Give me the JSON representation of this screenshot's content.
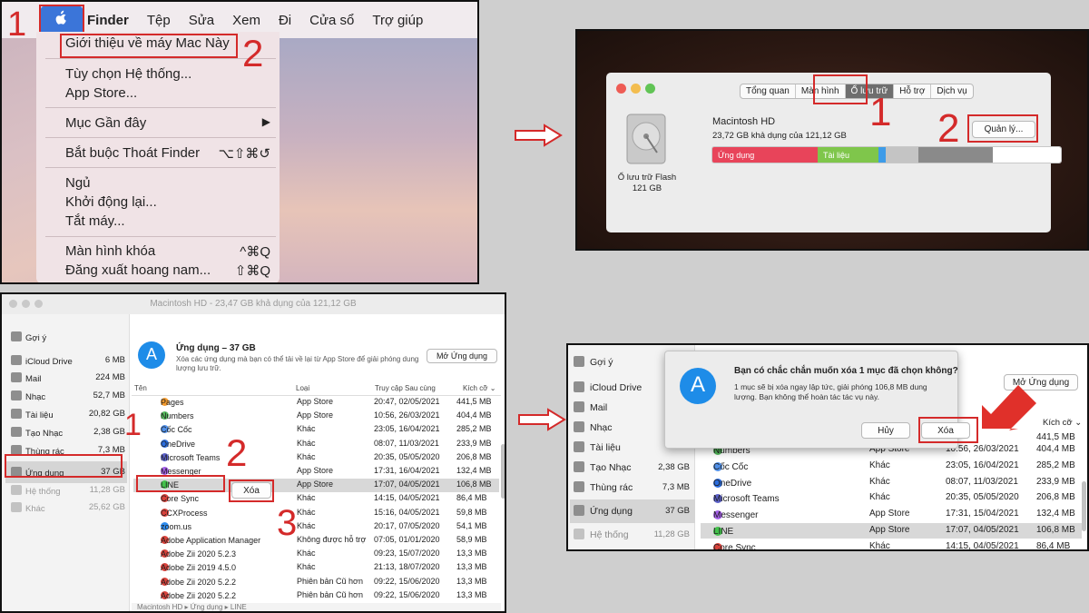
{
  "step1": {
    "apple_icon": "apple-logo",
    "menubar": [
      "Finder",
      "Tệp",
      "Sửa",
      "Xem",
      "Đi",
      "Cửa sổ",
      "Trợ giúp"
    ],
    "menu": {
      "about": "Giới thiệu về máy Mac Này",
      "prefs": "Tùy chọn Hệ thống...",
      "appstore": "App Store...",
      "recent": "Mục Gần đây",
      "force_quit": "Bắt buộc Thoát Finder",
      "force_quit_shortcut": "⌥⇧⌘↺",
      "sleep": "Ngủ",
      "restart": "Khởi động lại...",
      "shutdown": "Tắt máy...",
      "lock": "Màn hình khóa",
      "lock_shortcut": "^⌘Q",
      "logout": "Đăng xuất hoang nam...",
      "logout_shortcut": "⇧⌘Q"
    },
    "num1": "1",
    "num2": "2"
  },
  "step2": {
    "tabs": [
      "Tổng quan",
      "Màn hình",
      "Ổ lưu trữ",
      "Hỗ trợ",
      "Dịch vụ"
    ],
    "selected_tab": "Ổ lưu trữ",
    "disk_name": "Macintosh HD",
    "disk_free": "23,72 GB khả dụng của 121,12 GB",
    "disk_type": "Ổ lưu trữ Flash",
    "disk_size": "121 GB",
    "manage_button": "Quản lý...",
    "bar_apps": "Ứng dụng",
    "bar_docs": "Tài liệu",
    "num1": "1",
    "num2": "2",
    "colors": {
      "apps": "#e8445a",
      "docs": "#7fc64b",
      "other": "#8a8a8a"
    }
  },
  "step3": {
    "window_title": "Macintosh HD - 23,47 GB khả dụng của 121,12 GB",
    "sidebar": [
      {
        "label": "Gợi ý",
        "size": ""
      },
      {
        "label": "iCloud Drive",
        "size": "6 MB"
      },
      {
        "label": "Mail",
        "size": "224 MB"
      },
      {
        "label": "Nhạc",
        "size": "52,7 MB"
      },
      {
        "label": "Tài liệu",
        "size": "20,82 GB"
      },
      {
        "label": "Tạo Nhạc",
        "size": "2,38 GB"
      },
      {
        "label": "Thùng rác",
        "size": "7,3 MB"
      },
      {
        "label": "Ứng dụng",
        "size": "37 GB"
      },
      {
        "label": "Hệ thống",
        "size": "11,28 GB"
      },
      {
        "label": "Khác",
        "size": "25,62 GB"
      }
    ],
    "header_title": "Ứng dụng – 37 GB",
    "header_desc": "Xóa các ứng dụng mà bạn có thể tải về lại từ App Store để giải phóng dung lượng lưu trữ.",
    "open_button": "Mở Ứng dụng",
    "columns": [
      "Tên",
      "Loại",
      "Truy cập Sau cùng",
      "Kích cỡ ⌄"
    ],
    "rows": [
      {
        "name": "Pages",
        "kind": "App Store",
        "date": "20:47, 02/05/2021",
        "size": "441,5 MB"
      },
      {
        "name": "Numbers",
        "kind": "App Store",
        "date": "10:56, 26/03/2021",
        "size": "404,4 MB"
      },
      {
        "name": "Cốc Cốc",
        "kind": "Khác",
        "date": "23:05, 16/04/2021",
        "size": "285,2 MB"
      },
      {
        "name": "OneDrive",
        "kind": "Khác",
        "date": "08:07, 11/03/2021",
        "size": "233,9 MB"
      },
      {
        "name": "Microsoft Teams",
        "kind": "Khác",
        "date": "20:35, 05/05/2020",
        "size": "206,8 MB"
      },
      {
        "name": "Messenger",
        "kind": "App Store",
        "date": "17:31, 16/04/2021",
        "size": "132,4 MB"
      },
      {
        "name": "LINE",
        "kind": "App Store",
        "date": "17:07, 04/05/2021",
        "size": "106,8 MB"
      },
      {
        "name": "Core Sync",
        "kind": "Khác",
        "date": "14:15, 04/05/2021",
        "size": "86,4 MB"
      },
      {
        "name": "CCXProcess",
        "kind": "Khác",
        "date": "15:16, 04/05/2021",
        "size": "59,8 MB"
      },
      {
        "name": "zoom.us",
        "kind": "Khác",
        "date": "20:17, 07/05/2020",
        "size": "54,1 MB"
      },
      {
        "name": "Adobe Application Manager",
        "kind": "Không được hỗ trợ",
        "date": "07:05, 01/01/2020",
        "size": "58,9 MB"
      },
      {
        "name": "Adobe Zii 2020 5.2.3",
        "kind": "Khác",
        "date": "09:23, 15/07/2020",
        "size": "13,3 MB"
      },
      {
        "name": "Adobe Zii 2019 4.5.0",
        "kind": "Khác",
        "date": "21:13, 18/07/2020",
        "size": "13,3 MB"
      },
      {
        "name": "Adobe Zii 2020 5.2.2",
        "kind": "Phiên bản Cũ hơn",
        "date": "09:22, 15/06/2020",
        "size": "13,3 MB"
      },
      {
        "name": "Adobe Zii 2020 5.2.2",
        "kind": "Phiên bản Cũ hơn",
        "date": "09:22, 15/06/2020",
        "size": "13,3 MB"
      }
    ],
    "delete_button": "Xóa",
    "path_bar": "Macintosh HD ▸ Ứng dụng ▸ LINE",
    "num1": "1",
    "num2": "2",
    "num3": "3"
  },
  "step4": {
    "sidebar": [
      {
        "label": "Gợi ý",
        "size": ""
      },
      {
        "label": "iCloud Drive",
        "size": ""
      },
      {
        "label": "Mail",
        "size": ""
      },
      {
        "label": "Nhạc",
        "size": ""
      },
      {
        "label": "Tài liệu",
        "size": ""
      },
      {
        "label": "Tạo Nhạc",
        "size": "2,38 GB"
      },
      {
        "label": "Thùng rác",
        "size": "7,3 MB"
      },
      {
        "label": "Ứng dụng",
        "size": "37 GB"
      },
      {
        "label": "Hệ thống",
        "size": "11,28 GB"
      }
    ],
    "dialog_title": "Bạn có chắc chắn muốn xóa 1 mục đã chọn không?",
    "dialog_text": "1 mục sẽ bị xóa ngay lập tức, giải phóng 106,8 MB dung lượng. Bạn không thể hoàn tác tác vụ này.",
    "cancel_button": "Hủy",
    "delete_button": "Xóa",
    "open_button": "Mở Ứng dụng",
    "size_header": "Kích cỡ ⌄",
    "rows": [
      {
        "name": "Numbers",
        "kind": "App Store",
        "date": "10:56, 26/03/2021",
        "size": "404,4 MB"
      },
      {
        "name": "Cốc Cốc",
        "kind": "Khác",
        "date": "23:05, 16/04/2021",
        "size": "285,2 MB"
      },
      {
        "name": "OneDrive",
        "kind": "Khác",
        "date": "08:07, 11/03/2021",
        "size": "233,9 MB"
      },
      {
        "name": "Microsoft Teams",
        "kind": "Khác",
        "date": "20:35, 05/05/2020",
        "size": "206,8 MB"
      },
      {
        "name": "Messenger",
        "kind": "App Store",
        "date": "17:31, 15/04/2021",
        "size": "132,4 MB"
      },
      {
        "name": "LINE",
        "kind": "App Store",
        "date": "17:07, 04/05/2021",
        "size": "106,8 MB"
      },
      {
        "name": "Core Sync",
        "kind": "Khác",
        "date": "14:15, 04/05/2021",
        "size": "86,4 MB"
      }
    ],
    "first_size": "441,5 MB"
  }
}
